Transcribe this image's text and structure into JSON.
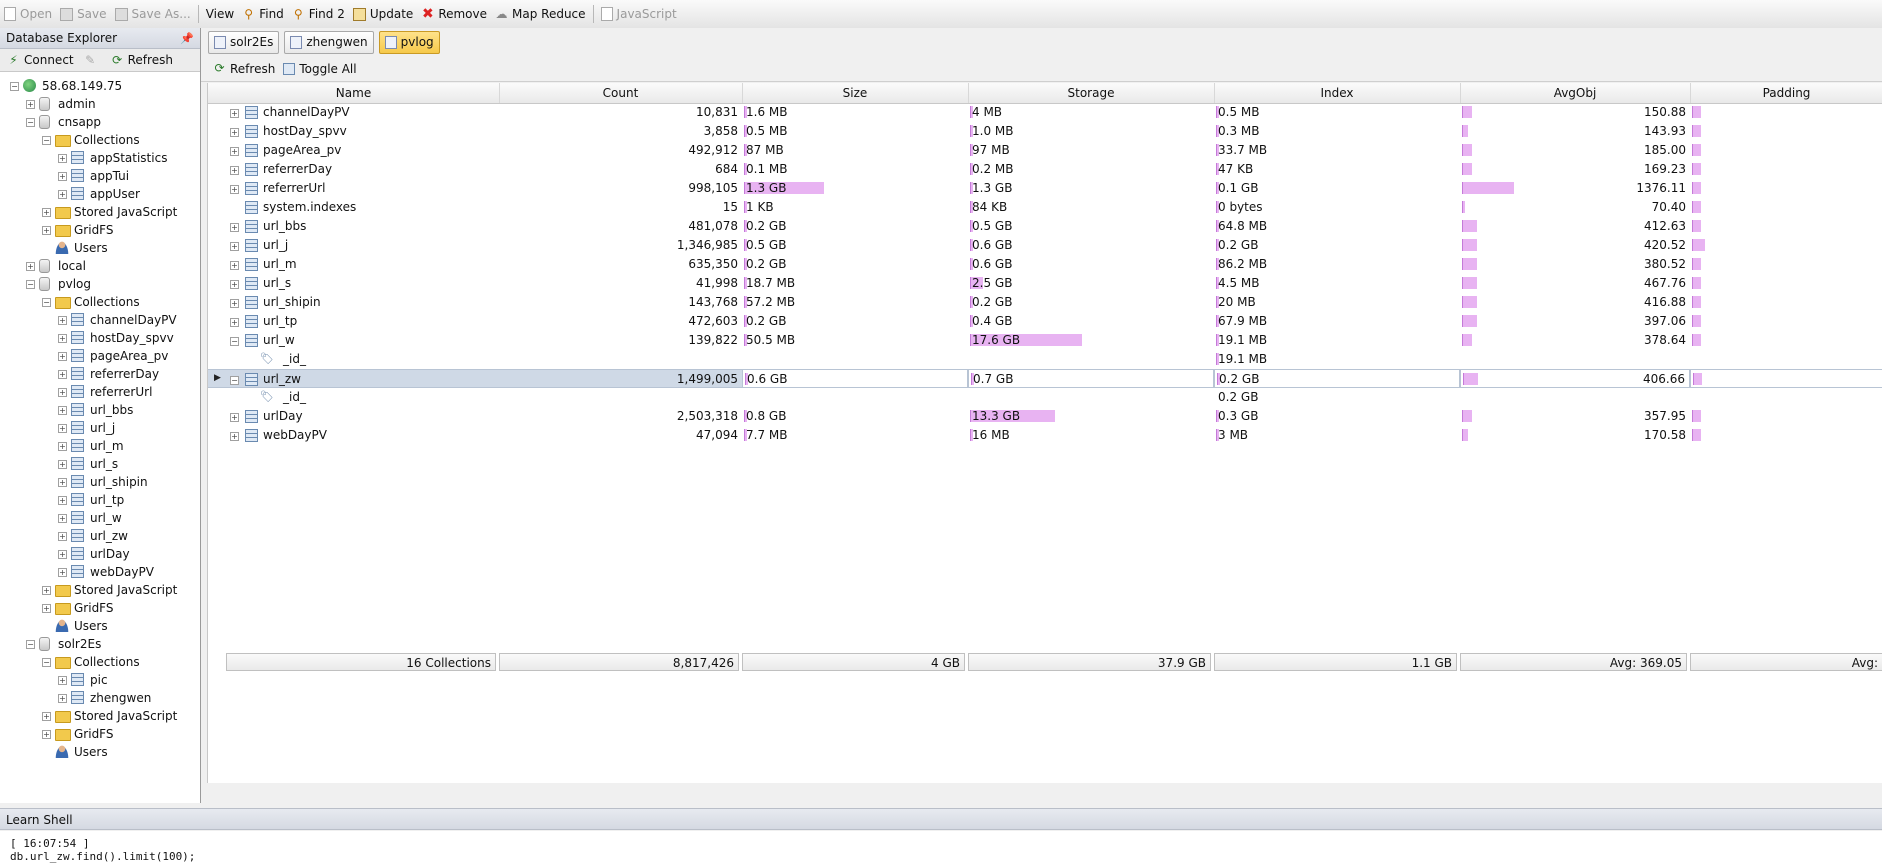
{
  "toolbar": {
    "open": "Open",
    "save": "Save",
    "save_as": "Save As...",
    "view": "View",
    "find": "Find",
    "find2": "Find 2",
    "update": "Update",
    "remove": "Remove",
    "map_reduce": "Map Reduce",
    "javascript": "JavaScript"
  },
  "explorer": {
    "title": "Database Explorer",
    "connect": "Connect",
    "refresh": "Refresh",
    "tree": [
      {
        "label": "58.68.149.75",
        "icon": "server"
      },
      {
        "label": "admin",
        "icon": "db"
      },
      {
        "label": "cnsapp",
        "icon": "db"
      },
      {
        "label": "Collections",
        "icon": "folder"
      },
      {
        "label": "appStatistics",
        "icon": "collection"
      },
      {
        "label": "appTui",
        "icon": "collection"
      },
      {
        "label": "appUser",
        "icon": "collection"
      },
      {
        "label": "Stored JavaScript",
        "icon": "folder"
      },
      {
        "label": "GridFS",
        "icon": "folder"
      },
      {
        "label": "Users",
        "icon": "user"
      },
      {
        "label": "local",
        "icon": "db"
      },
      {
        "label": "pvlog",
        "icon": "db"
      },
      {
        "label": "Collections",
        "icon": "folder"
      },
      {
        "label": "channelDayPV",
        "icon": "collection"
      },
      {
        "label": "hostDay_spvv",
        "icon": "collection"
      },
      {
        "label": "pageArea_pv",
        "icon": "collection"
      },
      {
        "label": "referrerDay",
        "icon": "collection"
      },
      {
        "label": "referrerUrl",
        "icon": "collection"
      },
      {
        "label": "url_bbs",
        "icon": "collection"
      },
      {
        "label": "url_j",
        "icon": "collection"
      },
      {
        "label": "url_m",
        "icon": "collection"
      },
      {
        "label": "url_s",
        "icon": "collection"
      },
      {
        "label": "url_shipin",
        "icon": "collection"
      },
      {
        "label": "url_tp",
        "icon": "collection"
      },
      {
        "label": "url_w",
        "icon": "collection"
      },
      {
        "label": "url_zw",
        "icon": "collection"
      },
      {
        "label": "urlDay",
        "icon": "collection"
      },
      {
        "label": "webDayPV",
        "icon": "collection"
      },
      {
        "label": "Stored JavaScript",
        "icon": "folder"
      },
      {
        "label": "GridFS",
        "icon": "folder"
      },
      {
        "label": "Users",
        "icon": "user"
      },
      {
        "label": "solr2Es",
        "icon": "db"
      },
      {
        "label": "Collections",
        "icon": "folder"
      },
      {
        "label": "pic",
        "icon": "collection"
      },
      {
        "label": "zhengwen",
        "icon": "collection"
      },
      {
        "label": "Stored JavaScript",
        "icon": "folder"
      },
      {
        "label": "GridFS",
        "icon": "folder"
      },
      {
        "label": "Users",
        "icon": "user"
      }
    ]
  },
  "tabs": [
    "solr2Es",
    "zhengwen",
    "pvlog"
  ],
  "grid_toolbar": {
    "refresh": "Refresh",
    "toggle_all": "Toggle All"
  },
  "columns": [
    "Name",
    "Count",
    "Size",
    "Storage",
    "Index",
    "AvgObj",
    "Padding"
  ],
  "rows": [
    {
      "name": "channelDayPV",
      "count": "10,831",
      "size": "1.6 MB",
      "storage": "4 MB",
      "index": "0.5 MB",
      "avgobj": "150.88",
      "size_pct": 0,
      "storage_pct": 0,
      "index_pct": 0,
      "avg_pct": 0.04,
      "pad_pct": 0.04
    },
    {
      "name": "hostDay_spvv",
      "count": "3,858",
      "size": "0.5 MB",
      "storage": "1.0 MB",
      "index": "0.3 MB",
      "avgobj": "143.93",
      "size_pct": 0,
      "storage_pct": 0,
      "index_pct": 0,
      "avg_pct": 0.02,
      "pad_pct": 0.04
    },
    {
      "name": "pageArea_pv",
      "count": "492,912",
      "size": "87 MB",
      "storage": "97 MB",
      "index": "33.7 MB",
      "avgobj": "185.00",
      "size_pct": 0,
      "storage_pct": 0,
      "index_pct": 0,
      "avg_pct": 0.04,
      "pad_pct": 0.04
    },
    {
      "name": "referrerDay",
      "count": "684",
      "size": "0.1 MB",
      "storage": "0.2 MB",
      "index": "47 KB",
      "avgobj": "169.23",
      "size_pct": 0,
      "storage_pct": 0,
      "index_pct": 0,
      "avg_pct": 0.04,
      "pad_pct": 0.04
    },
    {
      "name": "referrerUrl",
      "count": "998,105",
      "size": "1.3 GB",
      "storage": "1.3 GB",
      "index": "0.1 GB",
      "avgobj": "1376.11",
      "size_pct": 0.35,
      "storage_pct": 0.01,
      "index_pct": 0,
      "avg_pct": 0.22,
      "pad_pct": 0.04
    },
    {
      "name": "system.indexes",
      "count": "15",
      "size": "1 KB",
      "storage": "84 KB",
      "index": "0 bytes",
      "avgobj": "70.40",
      "size_pct": 0,
      "storage_pct": 0,
      "index_pct": 0,
      "avg_pct": 0.01,
      "pad_pct": 0.04,
      "no_expand": true
    },
    {
      "name": "url_bbs",
      "count": "481,078",
      "size": "0.2 GB",
      "storage": "0.5 GB",
      "index": "64.8 MB",
      "avgobj": "412.63",
      "size_pct": 0,
      "storage_pct": 0,
      "index_pct": 0,
      "avg_pct": 0.06,
      "pad_pct": 0.04
    },
    {
      "name": "url_j",
      "count": "1,346,985",
      "size": "0.5 GB",
      "storage": "0.6 GB",
      "index": "0.2 GB",
      "avgobj": "420.52",
      "size_pct": 0,
      "storage_pct": 0,
      "index_pct": 0,
      "avg_pct": 0.06,
      "pad_pct": 0.06
    },
    {
      "name": "url_m",
      "count": "635,350",
      "size": "0.2 GB",
      "storage": "0.6 GB",
      "index": "86.2 MB",
      "avgobj": "380.52",
      "size_pct": 0,
      "storage_pct": 0,
      "index_pct": 0,
      "avg_pct": 0.06,
      "pad_pct": 0.04
    },
    {
      "name": "url_s",
      "count": "41,998",
      "size": "18.7 MB",
      "storage": "2.5 GB",
      "index": "4.5 MB",
      "avgobj": "467.76",
      "size_pct": 0,
      "storage_pct": 0.05,
      "index_pct": 0,
      "avg_pct": 0.06,
      "pad_pct": 0.04
    },
    {
      "name": "url_shipin",
      "count": "143,768",
      "size": "57.2 MB",
      "storage": "0.2 GB",
      "index": "20 MB",
      "avgobj": "416.88",
      "size_pct": 0,
      "storage_pct": 0,
      "index_pct": 0.01,
      "avg_pct": 0.06,
      "pad_pct": 0.04
    },
    {
      "name": "url_tp",
      "count": "472,603",
      "size": "0.2 GB",
      "storage": "0.4 GB",
      "index": "67.9 MB",
      "avgobj": "397.06",
      "size_pct": 0,
      "storage_pct": 0,
      "index_pct": 0,
      "avg_pct": 0.06,
      "pad_pct": 0.04
    },
    {
      "name": "url_w",
      "count": "139,822",
      "size": "50.5 MB",
      "storage": "17.6 GB",
      "index": "19.1 MB",
      "avgobj": "378.64",
      "size_pct": 0,
      "storage_pct": 0.45,
      "index_pct": 0.01,
      "avg_pct": 0.04,
      "pad_pct": 0.04,
      "expanded": true
    },
    {
      "name": "_id_",
      "count": "",
      "size": "",
      "storage": "",
      "index": "19.1 MB",
      "avgobj": "",
      "child": true,
      "index_pct": 0.01
    },
    {
      "name": "url_zw",
      "count": "1,499,005",
      "size": "0.6 GB",
      "storage": "0.7 GB",
      "index": "0.2 GB",
      "avgobj": "406.66",
      "size_pct": 0,
      "storage_pct": 0,
      "index_pct": 0,
      "avg_pct": 0.06,
      "pad_pct": 0.04,
      "expanded": true,
      "selected": true
    },
    {
      "name": "_id_",
      "count": "",
      "size": "",
      "storage": "",
      "index": "0.2 GB",
      "avgobj": "",
      "child": true
    },
    {
      "name": "urlDay",
      "count": "2,503,318",
      "size": "0.8 GB",
      "storage": "13.3 GB",
      "index": "0.3 GB",
      "avgobj": "357.95",
      "size_pct": 0,
      "storage_pct": 0.34,
      "index_pct": 0,
      "avg_pct": 0.04,
      "pad_pct": 0.04
    },
    {
      "name": "webDayPV",
      "count": "47,094",
      "size": "7.7 MB",
      "storage": "16 MB",
      "index": "3 MB",
      "avgobj": "170.58",
      "size_pct": 0,
      "storage_pct": 0,
      "index_pct": 0,
      "avg_pct": 0.02,
      "pad_pct": 0.04
    }
  ],
  "footer": {
    "collections": "16 Collections",
    "count": "8,817,426",
    "size": "4 GB",
    "storage": "37.9 GB",
    "index": "1.1 GB",
    "avgobj": "Avg: 369.05",
    "padding": "Avg:"
  },
  "shell": {
    "title": "Learn Shell",
    "line1": "[ 16:07:54 ]",
    "line2": "db.url_zw.find().limit(100);"
  },
  "colors": {
    "bar": "#e8b3f2",
    "selected_row": "#cfd9e6",
    "active_tab": "#f6c94a"
  }
}
